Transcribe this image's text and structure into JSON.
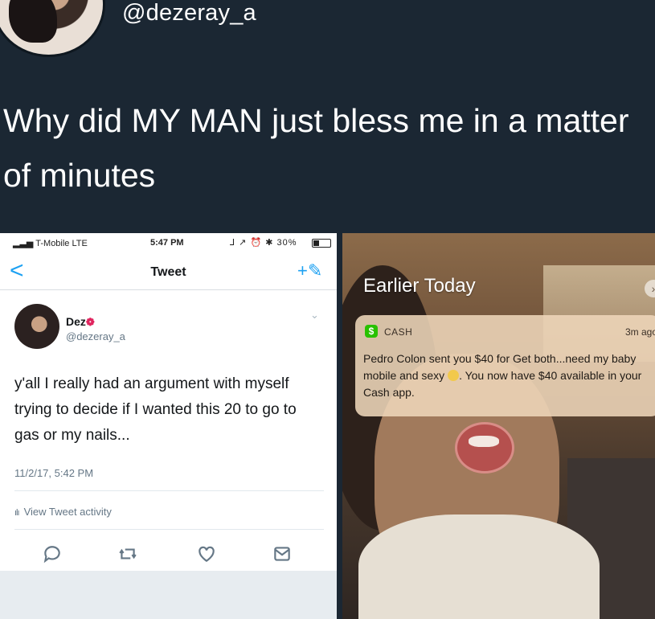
{
  "outer_tweet": {
    "handle": "@dezeray_a",
    "text": "Why did MY MAN just bless me in a matter of minutes"
  },
  "phone": {
    "status": {
      "carrier": "T-Mobile LTE",
      "time": "5:47 PM",
      "battery": "30%",
      "signal_icons": "⅃ ↗ ⏰ ✱"
    },
    "nav": {
      "back": "<",
      "title": "Tweet",
      "compose": "+✎"
    },
    "tweet": {
      "name": "Dez",
      "name_emoji": "❁",
      "handle": "@dezeray_a",
      "caret": "⌄",
      "body": "y'all I really had an argument with myself trying to decide if I wanted this 20 to go to gas or my nails...",
      "date": "11/2/17, 5:42 PM",
      "activity_icon": "ılı",
      "activity_label": "View Tweet activity"
    },
    "actions": [
      "reply-icon",
      "retweet-icon",
      "like-icon",
      "dm-icon"
    ]
  },
  "notification_photo": {
    "header": "Earlier Today",
    "chevron": "›",
    "notification": {
      "app_icon": "$",
      "app_name": "CASH",
      "time": "3m ago",
      "body_part1": "Pedro Colon sent you $40 for Get both...need my baby mobile and sexy",
      "body_part2": ". You now have $40 available in your Cash app."
    }
  },
  "colors": {
    "background": "#1b2733",
    "twitter_blue": "#1da1f2",
    "cash_green": "#28c101"
  }
}
